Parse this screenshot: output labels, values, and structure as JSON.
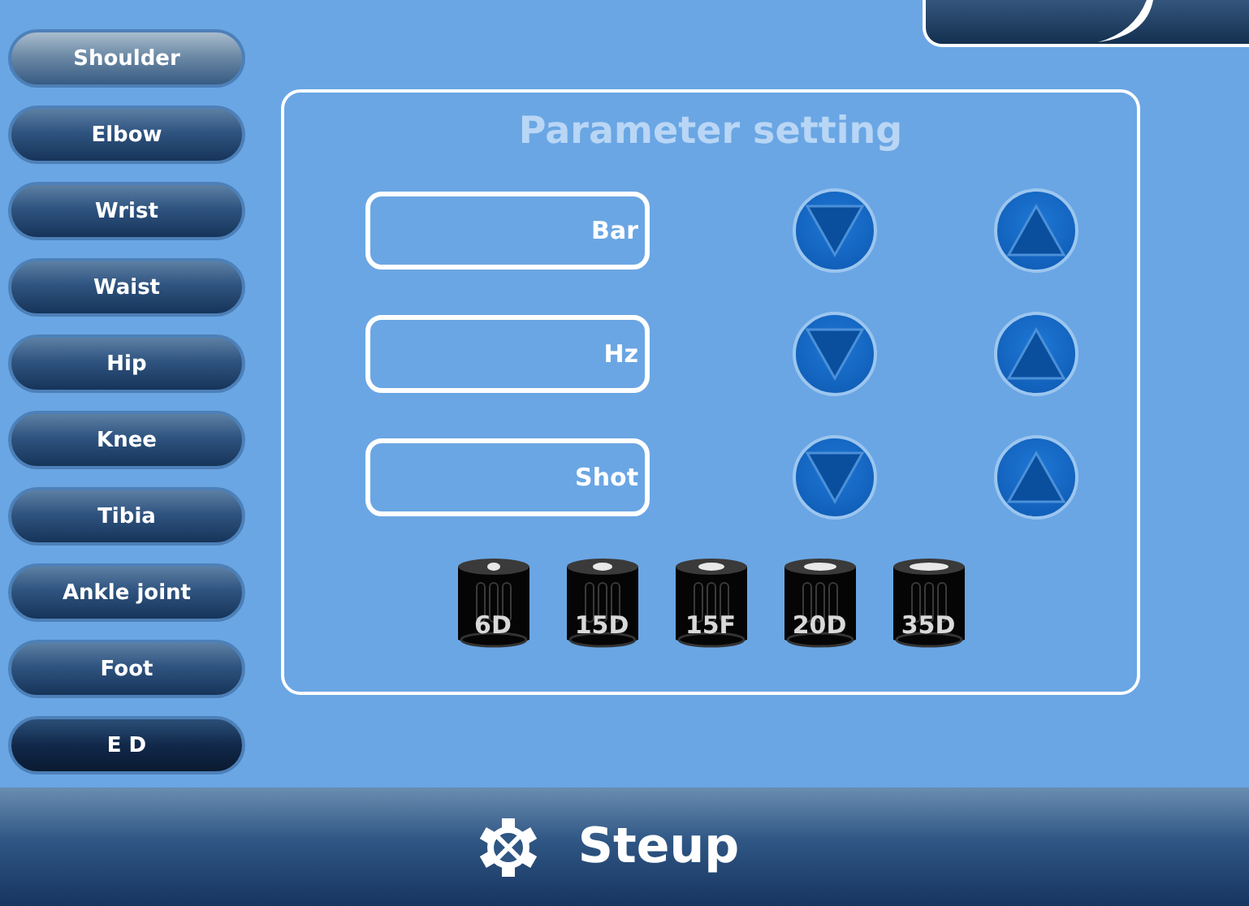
{
  "sidebar": {
    "items": [
      {
        "label": "Shoulder",
        "selected": true,
        "kind": "joint"
      },
      {
        "label": "Elbow",
        "selected": false,
        "kind": "joint"
      },
      {
        "label": "Wrist",
        "selected": false,
        "kind": "joint"
      },
      {
        "label": "Waist",
        "selected": false,
        "kind": "joint"
      },
      {
        "label": "Hip",
        "selected": false,
        "kind": "joint"
      },
      {
        "label": "Knee",
        "selected": false,
        "kind": "joint"
      },
      {
        "label": "Tibia",
        "selected": false,
        "kind": "joint"
      },
      {
        "label": "Ankle joint",
        "selected": false,
        "kind": "joint"
      },
      {
        "label": "Foot",
        "selected": false,
        "kind": "joint"
      },
      {
        "label": "E D",
        "selected": false,
        "kind": "mode"
      }
    ]
  },
  "panel": {
    "title": "Parameter setting",
    "parameters": [
      {
        "label": "Bar"
      },
      {
        "label": "Hz"
      },
      {
        "label": "Shot"
      }
    ],
    "transmitters": [
      {
        "label": "6D"
      },
      {
        "label": "15D"
      },
      {
        "label": "15F"
      },
      {
        "label": "20D"
      },
      {
        "label": "35D"
      }
    ]
  },
  "bottom_bar": {
    "label": "Steup"
  }
}
